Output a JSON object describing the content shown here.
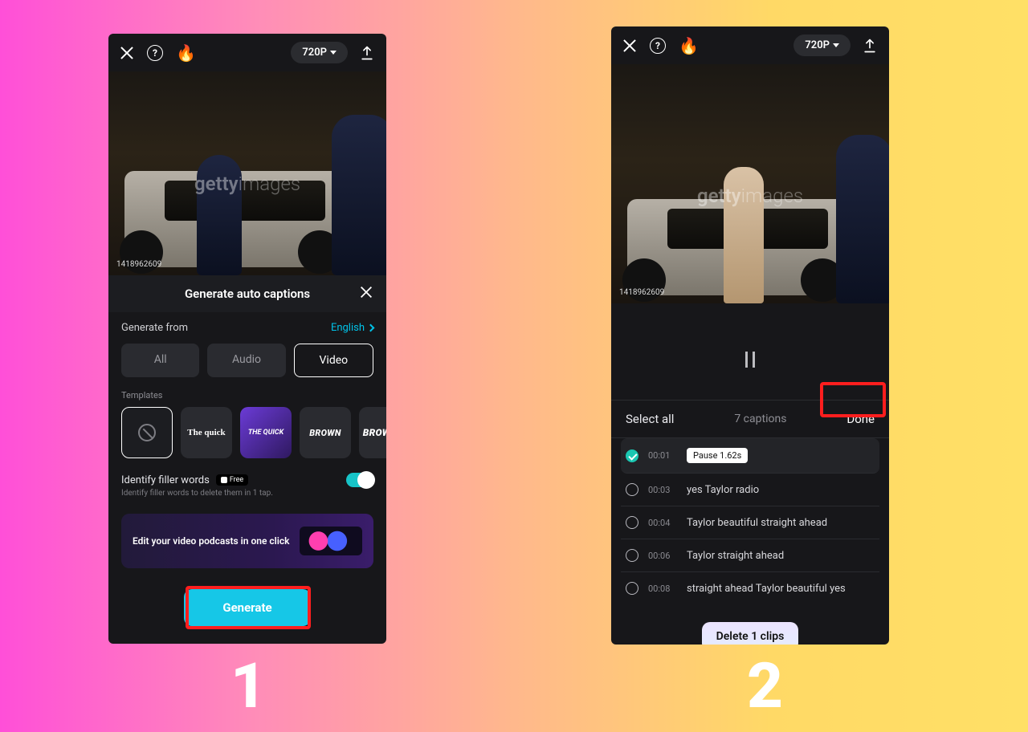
{
  "step_labels": {
    "one": "1",
    "two": "2"
  },
  "topbar": {
    "resolution": "720P",
    "help_glyph": "?",
    "flame_glyph": "🔥"
  },
  "preview": {
    "watermark_main": "getty",
    "watermark_sub": "images",
    "asset_id": "1418962609"
  },
  "panel1": {
    "title": "Generate auto captions",
    "generate_from_label": "Generate from",
    "language": "English",
    "tabs": {
      "all": "All",
      "audio": "Audio",
      "video": "Video"
    },
    "templates_label": "Templates",
    "templates": {
      "serif": "The quick",
      "quick": "THE QUICK",
      "brown_italic": "BROWN",
      "brown_cut": "BROW"
    },
    "filler_title": "Identify filler words",
    "filler_badge": "Free",
    "filler_sub": "Identify filler words to delete them in 1 tap.",
    "podcast_cta": "Edit your video podcasts in one click",
    "generate_btn": "Generate"
  },
  "panel2": {
    "select_all": "Select all",
    "caption_count": "7 captions",
    "done": "Done",
    "delete_btn": "Delete 1 clips",
    "items": [
      {
        "ts": "00:01",
        "pause_chip": "Pause 1.62s",
        "checked": true
      },
      {
        "ts": "00:03",
        "text": "yes Taylor radio",
        "checked": false
      },
      {
        "ts": "00:04",
        "text": "Taylor beautiful straight ahead",
        "checked": false
      },
      {
        "ts": "00:06",
        "text": "Taylor straight ahead",
        "checked": false
      },
      {
        "ts": "00:08",
        "text": "straight ahead Taylor beautiful yes",
        "checked": false
      }
    ]
  }
}
